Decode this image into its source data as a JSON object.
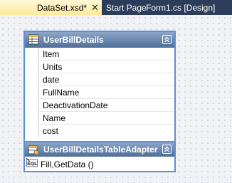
{
  "tabs": [
    {
      "label": "DataSet.xsd*",
      "active": true
    },
    {
      "label": "Start Page",
      "active": false
    },
    {
      "label": "Form1.cs [Design]",
      "active": false
    }
  ],
  "close_glyph": "✕",
  "datatable": {
    "title": "UserBillDetails",
    "icon": "table-icon",
    "columns": [
      "Item",
      "Units",
      "date",
      "FullName",
      "DeactivationDate",
      "Name",
      "cost"
    ]
  },
  "adapter": {
    "title": "UserBillDetailsTableAdapter",
    "icon": "table-adapter-icon",
    "query_icon": "sql-icon",
    "query": "Fill,GetData ()"
  },
  "colors": {
    "active_tab": "#fde99a",
    "tab_strip": "#2c3d5a",
    "header": "#5f7ca4",
    "border": "#5b8fd6"
  }
}
